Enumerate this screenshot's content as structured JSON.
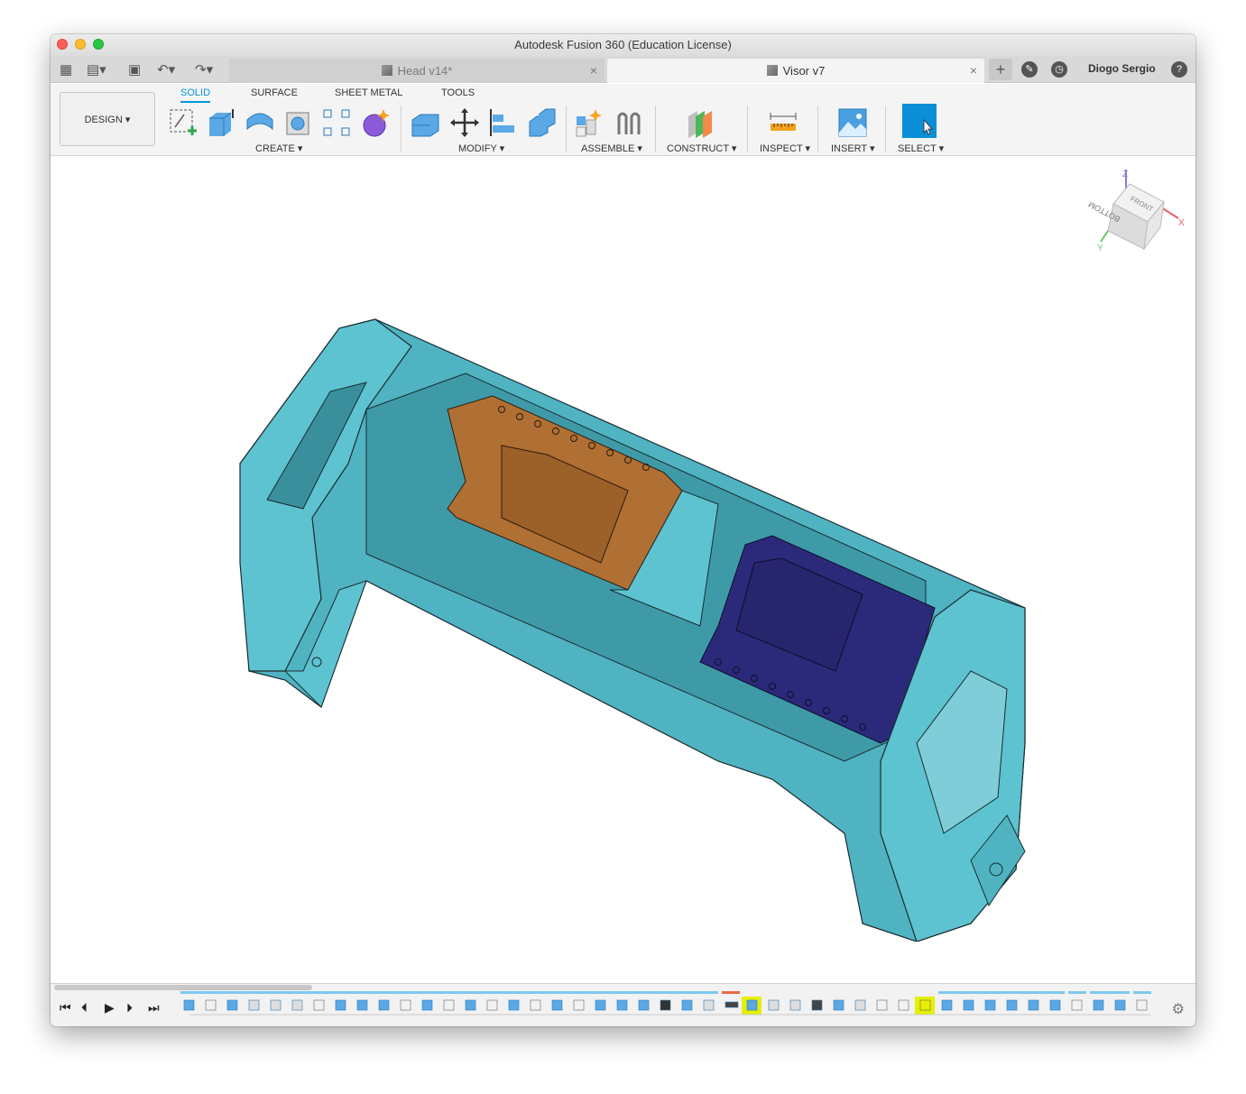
{
  "window": {
    "title": "Autodesk Fusion 360 (Education License)"
  },
  "tabs": {
    "inactive_label": "Head v14*",
    "active_label": "Visor v7",
    "close_glyph": "×"
  },
  "user": {
    "name": "Diogo Sergio",
    "help_glyph": "?"
  },
  "toolbar": {
    "workspace_label": "DESIGN",
    "ribbon_tabs": [
      "SOLID",
      "SURFACE",
      "SHEET METAL",
      "TOOLS"
    ],
    "groups": [
      "CREATE",
      "MODIFY",
      "ASSEMBLE",
      "CONSTRUCT",
      "INSPECT",
      "INSERT",
      "SELECT"
    ]
  },
  "viewcube": {
    "top_face": "FRONT",
    "side_face": "BOTTOM",
    "axis_x": "X",
    "axis_y": "Y",
    "axis_z": "Z"
  },
  "playback": {
    "first": "⏮",
    "prev": "⏴",
    "play": "▶",
    "next": "⏵",
    "last": "⏭"
  },
  "colors": {
    "accent": "#0696d7",
    "body": "#5ec3d1",
    "brown": "#b06f33",
    "navy": "#2b2a7a",
    "highlight": "#e6f000"
  }
}
